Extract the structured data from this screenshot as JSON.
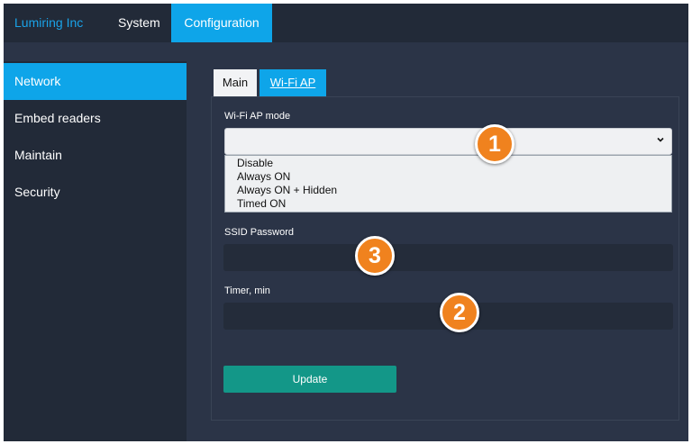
{
  "header": {
    "brand": "Lumiring Inc",
    "menu": [
      {
        "label": "System"
      },
      {
        "label": "Configuration",
        "active": true
      }
    ]
  },
  "sidebar": {
    "items": [
      {
        "label": "Network",
        "active": true
      },
      {
        "label": "Embed readers"
      },
      {
        "label": "Maintain"
      },
      {
        "label": "Security"
      }
    ]
  },
  "tabs": [
    {
      "label": "Main"
    },
    {
      "label": "Wi-Fi AP",
      "active": true
    }
  ],
  "form": {
    "wifi_mode_label": "Wi-Fi AP mode",
    "wifi_mode_value": "",
    "wifi_mode_options": [
      "Disable",
      "Always ON",
      "Always ON + Hidden",
      "Timed ON"
    ],
    "ssid_password_label": "SSID Password",
    "ssid_password_value": "",
    "timer_label": "Timer, min",
    "timer_value": "",
    "update_button": "Update"
  },
  "annotations": [
    "1",
    "2",
    "3"
  ],
  "colors": {
    "accent": "#0ea5e9",
    "background": "#2b3447",
    "nav_background": "#222a38",
    "button": "#139788",
    "marker": "#f0821e"
  },
  "icons": [
    "chevron-down-icon"
  ]
}
